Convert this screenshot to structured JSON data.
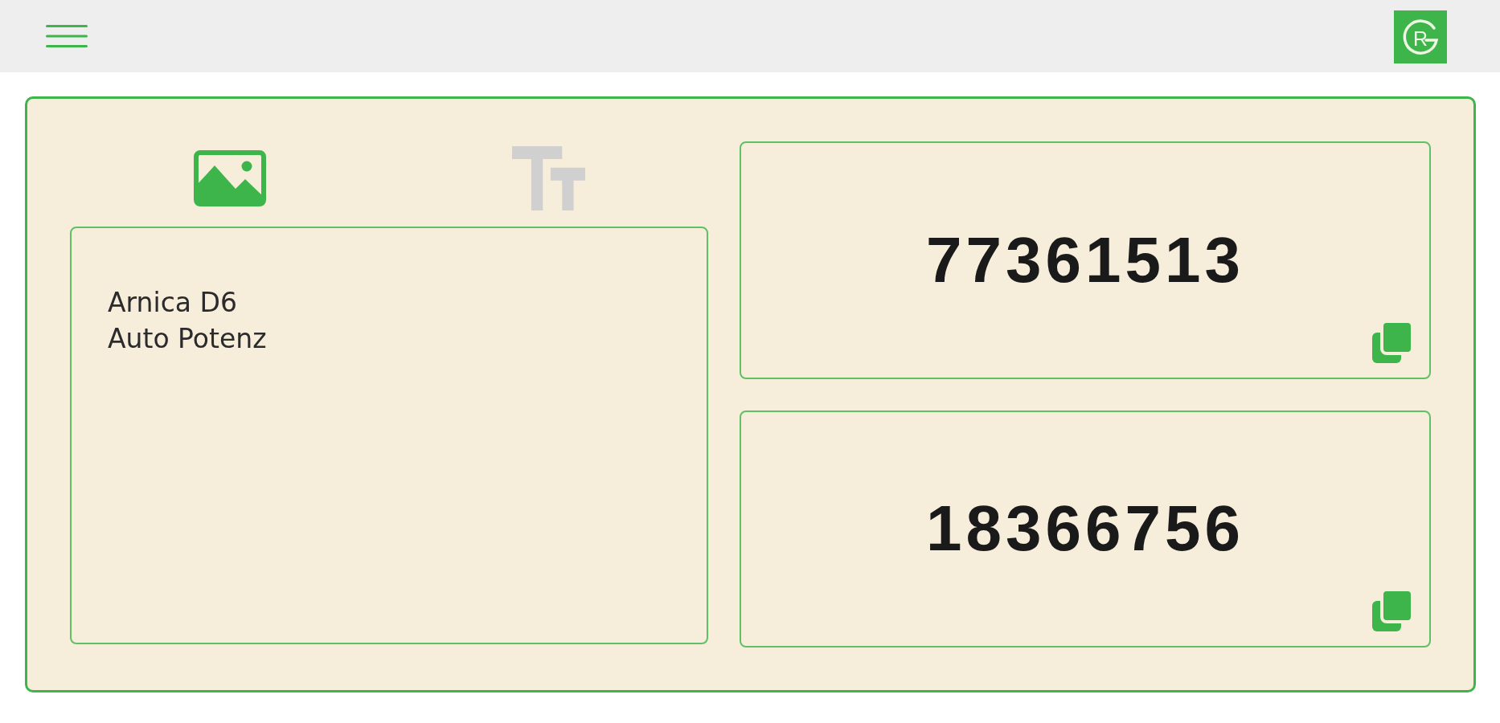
{
  "header": {
    "logo_text": "R"
  },
  "tabs": [
    {
      "kind": "image",
      "selected": true
    },
    {
      "kind": "text",
      "selected": false
    }
  ],
  "recognized_text": {
    "lines": [
      "Arnica D6",
      "Auto Potenz"
    ]
  },
  "numbers": [
    {
      "value": "77361513"
    },
    {
      "value": "18366756"
    }
  ]
}
